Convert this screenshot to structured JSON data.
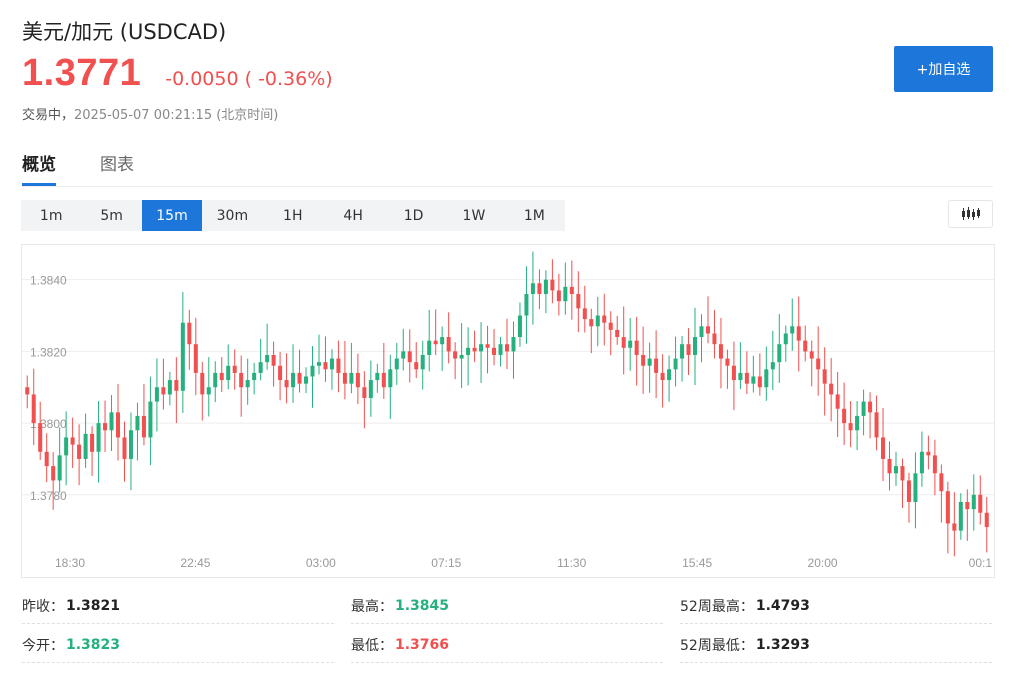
{
  "header": {
    "title": "美元/加元 (USDCAD)",
    "price": "1.3771",
    "change": "-0.0050 ( -0.36%)",
    "status_label": "交易中，",
    "timestamp": "2025-05-07 00:21:15 (北京时间)",
    "add_watchlist_label": "+加自选"
  },
  "tabs": [
    {
      "label": "概览",
      "active": true
    },
    {
      "label": "图表",
      "active": false
    }
  ],
  "periods": [
    {
      "label": "1m"
    },
    {
      "label": "5m"
    },
    {
      "label": "15m",
      "active": true
    },
    {
      "label": "30m"
    },
    {
      "label": "1H"
    },
    {
      "label": "4H"
    },
    {
      "label": "1D"
    },
    {
      "label": "1W"
    },
    {
      "label": "1M"
    }
  ],
  "icons": {
    "kline_toggle": "candlestick-icon"
  },
  "colors": {
    "up": "#26b07e",
    "down": "#f0504f",
    "accent": "#1d76d9"
  },
  "chart_data": {
    "type": "candlestick",
    "y_ticks": [
      "1.3840",
      "1.3820",
      "1.3800",
      "1.3780"
    ],
    "ylim": [
      1.3766,
      1.3848
    ],
    "x_ticks": [
      "18:30",
      "22:45",
      "03:00",
      "07:15",
      "11:30",
      "15:45",
      "20:00",
      "00:1"
    ],
    "grid": true,
    "closes": [
      1.3808,
      1.38,
      1.3792,
      1.3788,
      1.3784,
      1.3791,
      1.3796,
      1.3794,
      1.379,
      1.3797,
      1.3792,
      1.38,
      1.3798,
      1.3803,
      1.3796,
      1.379,
      1.3798,
      1.3802,
      1.3796,
      1.3806,
      1.381,
      1.3808,
      1.3812,
      1.3809,
      1.3828,
      1.3822,
      1.3814,
      1.3808,
      1.381,
      1.3814,
      1.3812,
      1.3816,
      1.3814,
      1.381,
      1.3812,
      1.3814,
      1.3817,
      1.3819,
      1.3816,
      1.3812,
      1.381,
      1.3814,
      1.3811,
      1.3813,
      1.3816,
      1.3817,
      1.3815,
      1.3818,
      1.3814,
      1.3811,
      1.3814,
      1.381,
      1.3807,
      1.3812,
      1.3814,
      1.381,
      1.3815,
      1.3818,
      1.382,
      1.3817,
      1.3815,
      1.3819,
      1.3823,
      1.3822,
      1.3824,
      1.382,
      1.3818,
      1.3819,
      1.3821,
      1.382,
      1.3822,
      1.3821,
      1.3819,
      1.3822,
      1.382,
      1.3824,
      1.383,
      1.3836,
      1.3839,
      1.3836,
      1.384,
      1.3837,
      1.3834,
      1.3838,
      1.3836,
      1.3832,
      1.3829,
      1.3827,
      1.383,
      1.3828,
      1.3826,
      1.3824,
      1.3821,
      1.3823,
      1.3819,
      1.3816,
      1.3818,
      1.3814,
      1.3812,
      1.3815,
      1.3818,
      1.3822,
      1.3819,
      1.3824,
      1.3827,
      1.3825,
      1.3822,
      1.3818,
      1.3816,
      1.3812,
      1.3814,
      1.3811,
      1.3813,
      1.381,
      1.3815,
      1.3817,
      1.3822,
      1.3825,
      1.3827,
      1.3823,
      1.382,
      1.3818,
      1.3815,
      1.3811,
      1.3808,
      1.3804,
      1.38,
      1.3798,
      1.3802,
      1.3806,
      1.3803,
      1.3796,
      1.379,
      1.3786,
      1.3788,
      1.3784,
      1.3778,
      1.3786,
      1.3792,
      1.3791,
      1.3786,
      1.3781,
      1.3772,
      1.377,
      1.3778,
      1.3776,
      1.378,
      1.3775,
      1.3771
    ]
  },
  "stats": [
    {
      "label": "昨收：",
      "value": "1.3821",
      "tone": "dark"
    },
    {
      "label": "最高：",
      "value": "1.3845",
      "tone": "green"
    },
    {
      "label": "52周最高：",
      "value": "1.4793",
      "tone": "dark"
    },
    {
      "label": "今开：",
      "value": "1.3823",
      "tone": "green"
    },
    {
      "label": "最低：",
      "value": "1.3766",
      "tone": "red"
    },
    {
      "label": "52周最低：",
      "value": "1.3293",
      "tone": "dark"
    }
  ]
}
